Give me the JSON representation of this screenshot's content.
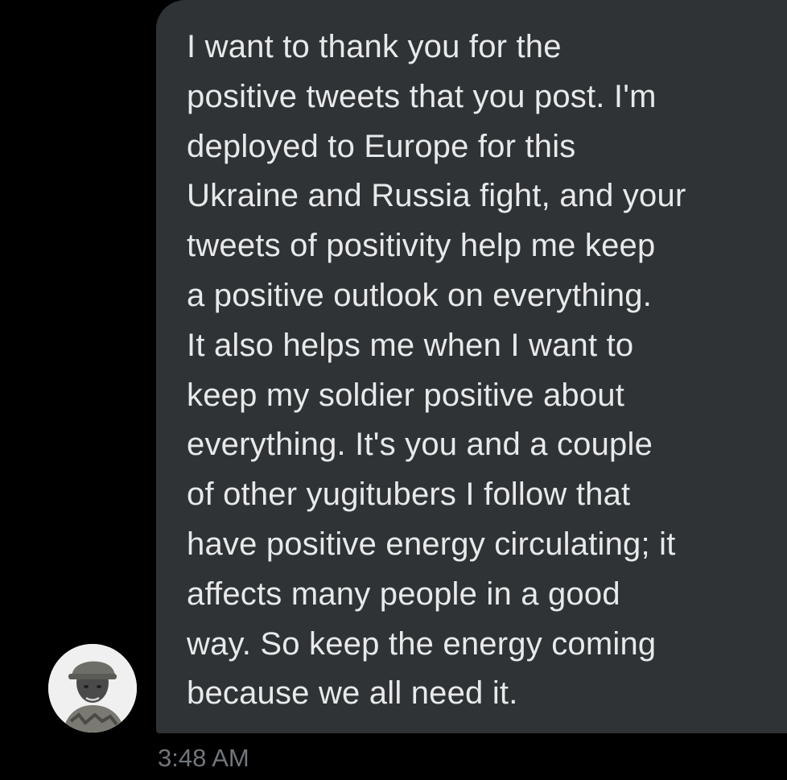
{
  "message": {
    "text": "I want to thank you for the\npositive tweets that you post. I'm\ndeployed to Europe for this\nUkraine and Russia fight, and your\ntweets of positivity help me keep\na positive outlook on everything.\nIt also helps me when I want to\nkeep my soldier positive about\neverything. It's you and a couple\nof other yugitubers I follow that\nhave positive energy circulating; it\naffects many people in a good\nway. So keep the energy coming\nbecause we all need it.",
    "timestamp": "3:48 AM"
  },
  "colors": {
    "background": "#000000",
    "bubble": "#2f3336",
    "text": "#e7e9ea",
    "timestamp": "#71767b"
  },
  "icons": {
    "avatar": "sender-avatar-photo"
  }
}
